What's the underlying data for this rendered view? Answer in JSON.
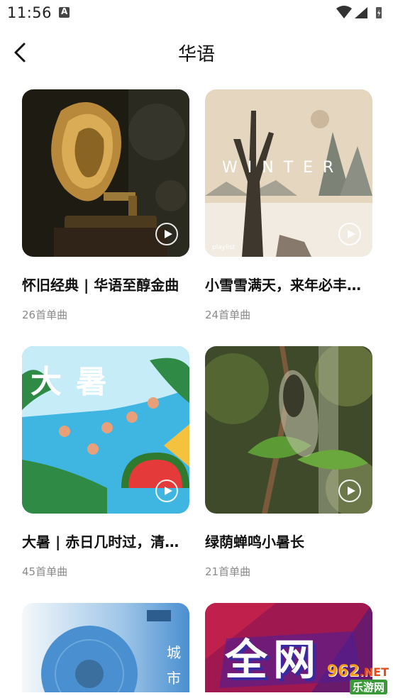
{
  "status": {
    "time": "11:56"
  },
  "header": {
    "title": "华语"
  },
  "playlists": [
    {
      "title": "怀旧经典 | 华语至醇金曲",
      "count": "26首单曲"
    },
    {
      "title": "小雪雪满天，来年必丰…",
      "count": "24首单曲",
      "cover_text": "WINTER",
      "cover_small": "playlist"
    },
    {
      "title": "大暑 | 赤日几时过，清…",
      "count": "45首单曲",
      "cover_text": "大暑"
    },
    {
      "title": "绿荫蝉鸣小暑长",
      "count": "21首单曲"
    },
    {
      "cover_text_1": "城",
      "cover_text_2": "市"
    },
    {
      "cover_text": "全网"
    }
  ],
  "watermark": {
    "num": "962",
    "suffix": ".NET",
    "name": "乐游网"
  }
}
